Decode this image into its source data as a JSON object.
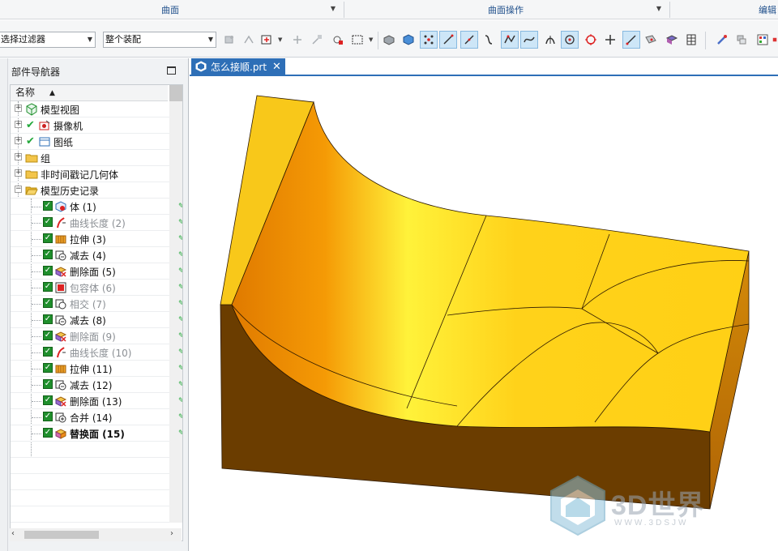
{
  "ribbon": {
    "groups": [
      {
        "label": "曲面"
      },
      {
        "label": "曲面操作"
      },
      {
        "label": "编辑"
      }
    ]
  },
  "toolbar": {
    "filter_select": {
      "value": "选择过滤器"
    },
    "scope_select": {
      "value": "整个装配"
    },
    "icons": [
      "face-rule-icon",
      "snap-icon",
      "select-box-icon",
      "point-icon",
      "edge-icon",
      "vertex-icon",
      "rectangle-select-icon",
      "body-icon",
      "solid-icon",
      "control-point-icon",
      "line-snap-icon",
      "tangent-icon",
      "curve-icon",
      "polyline-icon",
      "spline-icon",
      "intersection-icon",
      "center-point-icon",
      "circle-point-icon",
      "crosshair-icon",
      "end-point-icon",
      "surface-point-icon",
      "view-icon",
      "grid-icon",
      "pen-icon",
      "layer-icon",
      "table-icon",
      "color-icon"
    ]
  },
  "navigator": {
    "title": "部件导航器",
    "column_header": "名称",
    "nodes": [
      {
        "label": "模型视图",
        "icon": "model-view-icon",
        "expandable": true,
        "checked": false,
        "dim": false
      },
      {
        "label": "摄像机",
        "icon": "camera-icon",
        "expandable": true,
        "checked": true,
        "dim": false
      },
      {
        "label": "图纸",
        "icon": "drawing-icon",
        "expandable": true,
        "checked": true,
        "dim": false
      },
      {
        "label": "组",
        "icon": "folder-icon",
        "expandable": true,
        "checked": false,
        "dim": false
      },
      {
        "label": "非时间戳记几何体",
        "icon": "folder-icon",
        "expandable": true,
        "checked": false,
        "dim": false
      },
      {
        "label": "模型历史记录",
        "icon": "folder-open-icon",
        "expandable": true,
        "checked": false,
        "dim": false
      }
    ],
    "history": [
      {
        "label": "体 (1)",
        "icon": "body-feature-icon",
        "dim": false,
        "bold": false
      },
      {
        "label": "曲线长度 (2)",
        "icon": "curve-length-icon",
        "dim": true,
        "bold": false
      },
      {
        "label": "拉伸 (3)",
        "icon": "extrude-icon",
        "dim": false,
        "bold": false
      },
      {
        "label": "减去 (4)",
        "icon": "subtract-icon",
        "dim": false,
        "bold": false
      },
      {
        "label": "删除面 (5)",
        "icon": "delete-face-icon",
        "dim": false,
        "bold": false
      },
      {
        "label": "包容体 (6)",
        "icon": "bounding-body-icon",
        "dim": true,
        "bold": false
      },
      {
        "label": "相交 (7)",
        "icon": "intersect-icon",
        "dim": true,
        "bold": false
      },
      {
        "label": "减去 (8)",
        "icon": "subtract-icon",
        "dim": false,
        "bold": false
      },
      {
        "label": "删除面 (9)",
        "icon": "delete-face-icon",
        "dim": true,
        "bold": false
      },
      {
        "label": "曲线长度 (10)",
        "icon": "curve-length-icon",
        "dim": true,
        "bold": false
      },
      {
        "label": "拉伸 (11)",
        "icon": "extrude-icon",
        "dim": false,
        "bold": false
      },
      {
        "label": "减去 (12)",
        "icon": "subtract-icon",
        "dim": false,
        "bold": false
      },
      {
        "label": "删除面 (13)",
        "icon": "delete-face-icon",
        "dim": false,
        "bold": false
      },
      {
        "label": "合并 (14)",
        "icon": "unite-icon",
        "dim": false,
        "bold": false
      },
      {
        "label": "替换面 (15)",
        "icon": "replace-face-icon",
        "dim": false,
        "bold": true
      }
    ]
  },
  "document": {
    "tab_title": "怎么接顺.prt",
    "close_glyph": "✕"
  },
  "watermark": {
    "text": "3D世界",
    "subtext": "WWW.3DSJW"
  },
  "colors": {
    "accent": "#2e6fb7",
    "model_top": "#f8c81a",
    "model_side": "#6b3d00",
    "model_right": "#c97c07",
    "check_green": "#22a83a"
  }
}
